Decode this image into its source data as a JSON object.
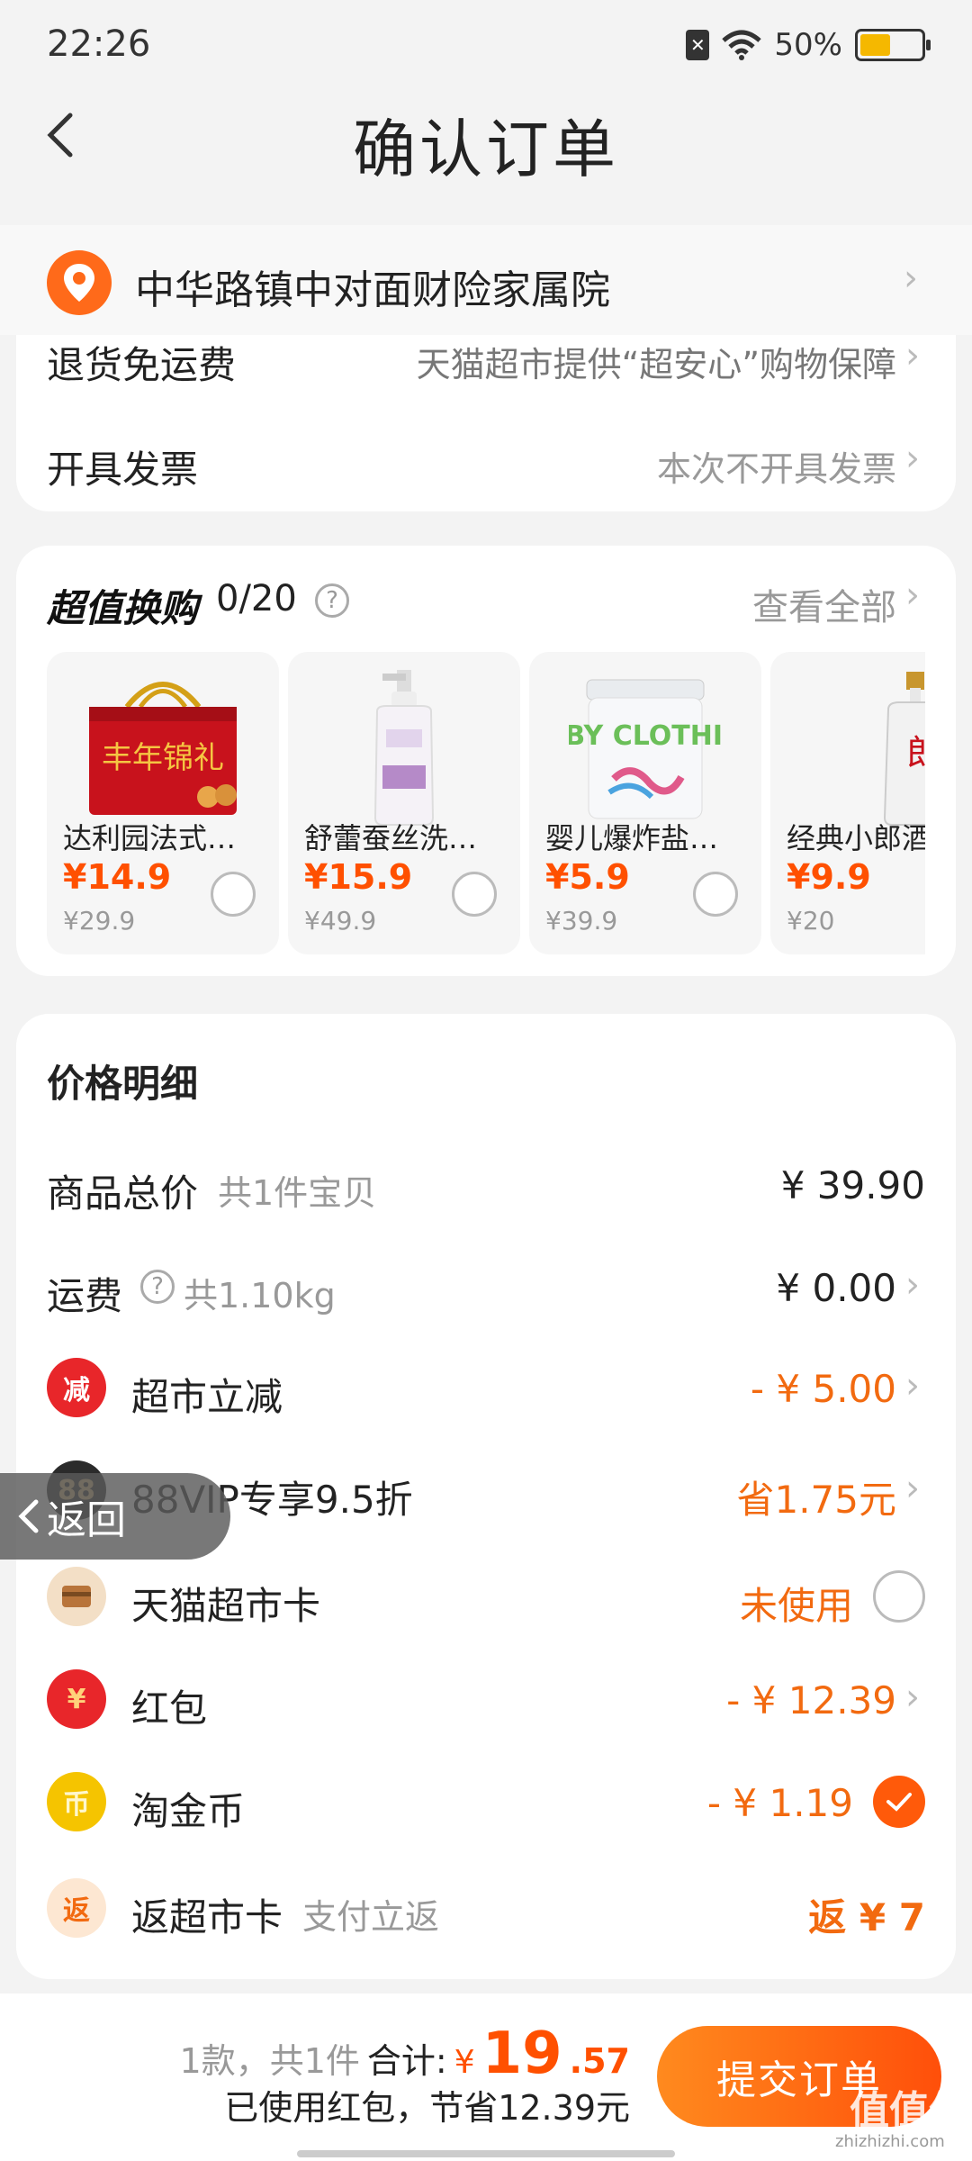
{
  "status_bar": {
    "time": "22:26",
    "battery": "50%",
    "battery_level": 0.5,
    "icons": [
      "sim-off-icon",
      "wifi-icon",
      "battery-icon"
    ]
  },
  "header": {
    "title": "确认订单",
    "back_icon": "chevron-left-icon"
  },
  "address": {
    "text": "中华路镇中对面财险家属院",
    "icon": "location-pin-icon"
  },
  "services": [
    {
      "label": "退货免运费",
      "value": "天猫超市提供“超安心”购物保障"
    },
    {
      "label": "开具发票",
      "value": "本次不开具发票"
    }
  ],
  "swap": {
    "title": "超值换购",
    "count": "0/20",
    "view_all": "查看全部",
    "products": [
      {
        "name": "达利园法式…",
        "price": "¥14.9",
        "original": "¥29.9",
        "image": "gift-box-image",
        "selected": false
      },
      {
        "name": "舒蕾蚕丝洗…",
        "price": "¥15.9",
        "original": "¥49.9",
        "image": "shampoo-bottle-image",
        "selected": false
      },
      {
        "name": "婴儿爆炸盐…",
        "price": "¥5.9",
        "original": "¥39.9",
        "image": "detergent-tub-image",
        "selected": false
      },
      {
        "name": "经典小郎酒",
        "price": "¥9.9",
        "original": "¥20",
        "image": "liquor-bottle-image",
        "selected": false
      }
    ],
    "product_label_chars": {
      "dahao": "郎"
    },
    "box_text": "丰年锦礼",
    "tub_text": "BABY CLOTHING"
  },
  "price_detail": {
    "title": "价格明细",
    "rows": [
      {
        "label": "商品总价",
        "hint": "共1件宝贝",
        "value": "¥ 39.90"
      },
      {
        "label": "运费",
        "hint": "共1.10kg",
        "value": "¥ 0.00"
      },
      {
        "label": "超市立减",
        "value": "- ¥ 5.00",
        "icon_text": "减"
      },
      {
        "label": "88VIP专享9.5折",
        "value": "省1.75元",
        "icon_text": "88"
      },
      {
        "label": "天猫超市卡",
        "value": "未使用"
      },
      {
        "label": "红包",
        "value": "- ¥ 12.39",
        "icon_text": "¥"
      },
      {
        "label": "淘金币",
        "value": "- ¥ 1.19",
        "icon_text": "币"
      },
      {
        "label": "返超市卡",
        "hint": "支付立返",
        "value": "返 ¥ 7",
        "icon_text": "返"
      }
    ]
  },
  "float_back": "返回",
  "footer": {
    "count_text": "1款，共1件",
    "total_label": "合计:",
    "currency": "¥",
    "total_int": "19",
    "total_dec": ".57",
    "saving_text": "已使用红包，节省12.39元",
    "submit": "提交订单",
    "watermark": "值值值",
    "watermark_url": "zhizhizhi.com"
  },
  "colors": {
    "accent": "#ff5000",
    "orange_text": "#f26a10"
  }
}
